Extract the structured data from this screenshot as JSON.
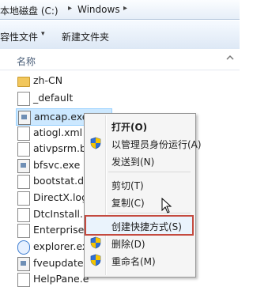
{
  "address": {
    "root": "本地磁盘 (C:)",
    "sep": "▸",
    "folder": "Windows",
    "sep2": "▸"
  },
  "toolbar": {
    "left_button": "容性文件",
    "new_folder": "新建文件夹",
    "caret": "▾"
  },
  "column_header": "名称",
  "files": [
    {
      "name": "zh-CN",
      "icon": "folder-icon"
    },
    {
      "name": "_default",
      "icon": "document-icon"
    },
    {
      "name": "amcap.exe",
      "icon": "exe-icon",
      "selected": true
    },
    {
      "name": "atiogl.xml",
      "icon": "document-icon"
    },
    {
      "name": "ativpsrm.b",
      "icon": "document-icon"
    },
    {
      "name": "bfsvc.exe",
      "icon": "exe-icon"
    },
    {
      "name": "bootstat.d",
      "icon": "document-icon"
    },
    {
      "name": "DirectX.log",
      "icon": "document-icon"
    },
    {
      "name": "DtcInstall.lo",
      "icon": "document-icon"
    },
    {
      "name": "Enterprise.",
      "icon": "document-icon"
    },
    {
      "name": "explorer.ex",
      "icon": "explorer-icon"
    },
    {
      "name": "fveupdate.",
      "icon": "exe-icon"
    },
    {
      "name": "HelpPane.e",
      "icon": "document-icon"
    }
  ],
  "context_menu": [
    {
      "label": "打开(O)",
      "bold": true,
      "shield": false
    },
    {
      "label": "以管理员身份运行(A)",
      "bold": false,
      "shield": true
    },
    {
      "label": "发送到(N)",
      "bold": false,
      "shield": false
    },
    {
      "label": "剪切(T)",
      "bold": false,
      "shield": false
    },
    {
      "label": "复制(C)",
      "bold": false,
      "shield": false
    },
    {
      "label": "创建快捷方式(S)",
      "bold": false,
      "shield": false,
      "highlight": true
    },
    {
      "label": "删除(D)",
      "bold": false,
      "shield": true
    },
    {
      "label": "重命名(M)",
      "bold": false,
      "shield": true
    }
  ],
  "colors": {
    "highlight_border": "#c44a3f",
    "selection": "#cce8ff"
  }
}
